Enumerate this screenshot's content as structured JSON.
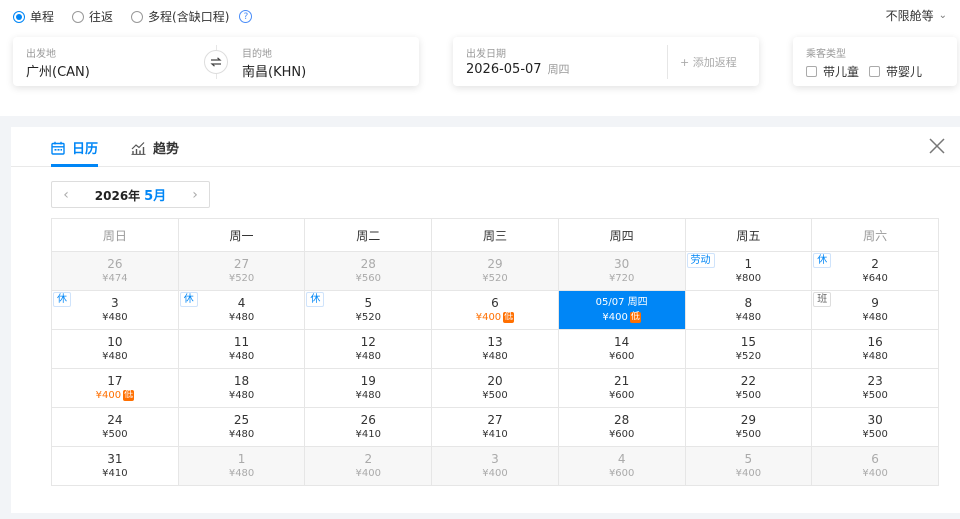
{
  "search": {
    "trip_types": [
      {
        "label": "单程",
        "selected": true
      },
      {
        "label": "往返",
        "selected": false
      },
      {
        "label": "多程(含缺口程)",
        "selected": false
      }
    ],
    "help_icon": "?",
    "cabin": "不限舱等",
    "from_label": "出发地",
    "from_value": "广州(CAN)",
    "to_label": "目的地",
    "to_value": "南昌(KHN)",
    "date_label": "出发日期",
    "date_value": "2026-05-07",
    "date_weekday": "周四",
    "add_return": "+ 添加返程",
    "pax_label": "乘客类型",
    "child": "带儿童",
    "infant": "带婴儿"
  },
  "calendar": {
    "tab_calendar": "日历",
    "tab_trend": "趋势",
    "year": "2026年",
    "month": "5月",
    "prev": "‹",
    "next": "›",
    "weekdays": [
      "周日",
      "周一",
      "周二",
      "周三",
      "周四",
      "周五",
      "周六"
    ],
    "cells": [
      {
        "day": "26",
        "price": "¥474",
        "other": true
      },
      {
        "day": "27",
        "price": "¥520",
        "other": true
      },
      {
        "day": "28",
        "price": "¥560",
        "other": true
      },
      {
        "day": "29",
        "price": "¥520",
        "other": true
      },
      {
        "day": "30",
        "price": "¥720",
        "other": true
      },
      {
        "day": "1",
        "price": "¥800",
        "tag": "劳动"
      },
      {
        "day": "2",
        "price": "¥640",
        "tag": "休"
      },
      {
        "day": "3",
        "price": "¥480",
        "tag": "休"
      },
      {
        "day": "4",
        "price": "¥480",
        "tag": "休"
      },
      {
        "day": "5",
        "price": "¥520",
        "tag": "休"
      },
      {
        "day": "6",
        "price": "¥400",
        "low": "低"
      },
      {
        "day": "05/07 周四",
        "price": "¥400",
        "low": "低",
        "selected": true
      },
      {
        "day": "8",
        "price": "¥480"
      },
      {
        "day": "9",
        "price": "¥480",
        "tag": "班",
        "work": true
      },
      {
        "day": "10",
        "price": "¥480"
      },
      {
        "day": "11",
        "price": "¥480"
      },
      {
        "day": "12",
        "price": "¥480"
      },
      {
        "day": "13",
        "price": "¥480"
      },
      {
        "day": "14",
        "price": "¥600"
      },
      {
        "day": "15",
        "price": "¥520"
      },
      {
        "day": "16",
        "price": "¥480"
      },
      {
        "day": "17",
        "price": "¥400",
        "low": "低"
      },
      {
        "day": "18",
        "price": "¥480"
      },
      {
        "day": "19",
        "price": "¥480"
      },
      {
        "day": "20",
        "price": "¥500"
      },
      {
        "day": "21",
        "price": "¥600"
      },
      {
        "day": "22",
        "price": "¥500"
      },
      {
        "day": "23",
        "price": "¥500"
      },
      {
        "day": "24",
        "price": "¥500"
      },
      {
        "day": "25",
        "price": "¥480"
      },
      {
        "day": "26",
        "price": "¥410"
      },
      {
        "day": "27",
        "price": "¥410"
      },
      {
        "day": "28",
        "price": "¥600"
      },
      {
        "day": "29",
        "price": "¥500"
      },
      {
        "day": "30",
        "price": "¥500"
      },
      {
        "day": "31",
        "price": "¥410"
      },
      {
        "day": "1",
        "price": "¥480",
        "other": true
      },
      {
        "day": "2",
        "price": "¥400",
        "other": true
      },
      {
        "day": "3",
        "price": "¥400",
        "other": true
      },
      {
        "day": "4",
        "price": "¥600",
        "other": true
      },
      {
        "day": "5",
        "price": "¥400",
        "other": true
      },
      {
        "day": "6",
        "price": "¥400",
        "other": true
      }
    ]
  },
  "colors": {
    "accent": "#0086f6",
    "low_price": "#ff6f00"
  }
}
